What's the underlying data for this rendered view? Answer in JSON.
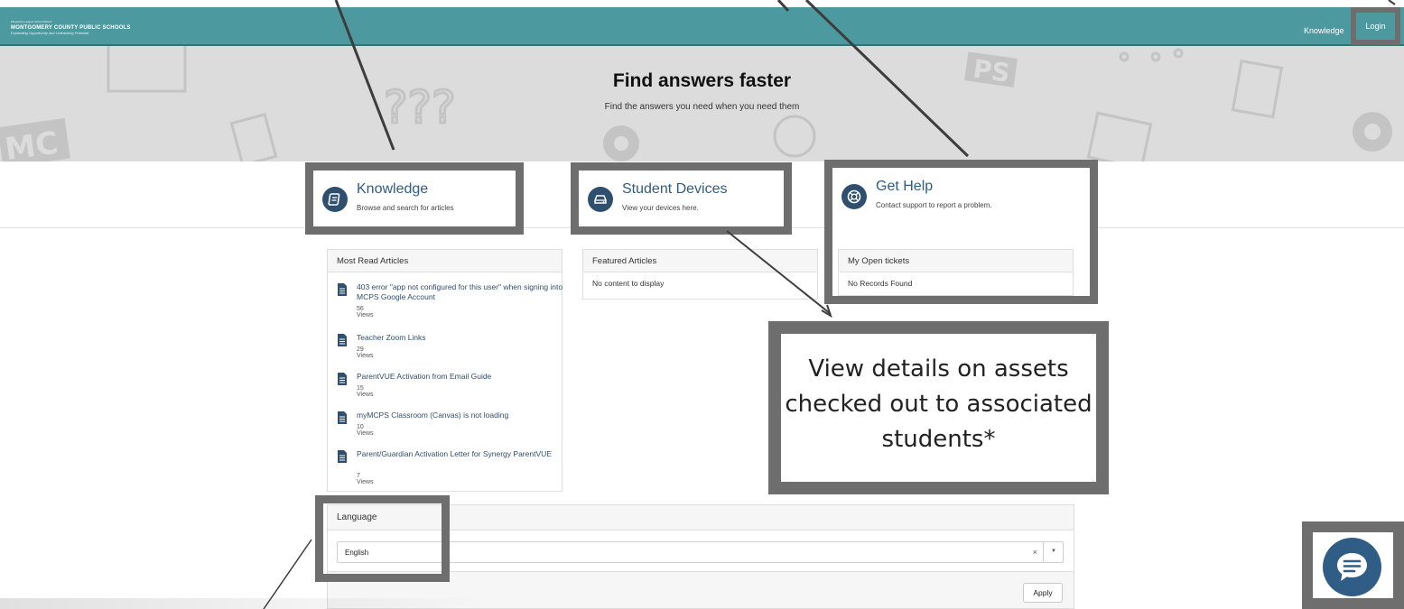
{
  "header": {
    "logo": {
      "tagline_top": "Maryland's Largest School District",
      "name": "MONTGOMERY COUNTY PUBLIC SCHOOLS",
      "tagline_bottom": "Expanding Opportunity and Unleashing Potential"
    },
    "nav": {
      "knowledge": "Knowledge",
      "login": "Login"
    }
  },
  "hero": {
    "title": "Find answers faster",
    "subtitle": "Find the answers you need when you need them"
  },
  "cards": [
    {
      "title": "Knowledge",
      "description": "Browse and search for articles",
      "icon": "book-icon"
    },
    {
      "title": "Student Devices",
      "description": "View your devices here.",
      "icon": "device-icon"
    },
    {
      "title": "Get Help",
      "description": "Contact support to report a problem.",
      "icon": "lifebuoy-icon"
    }
  ],
  "most_read": {
    "header": "Most Read Articles",
    "articles": [
      {
        "title": "403 error \"app not configured for this user\" when signing into MCPS Google Account",
        "views": "56 Views"
      },
      {
        "title": "Teacher Zoom Links",
        "views": "29 Views"
      },
      {
        "title": "ParentVUE Activation from Email Guide",
        "views": "15 Views"
      },
      {
        "title": "myMCPS Classroom (Canvas) is not loading",
        "views": "10 Views"
      },
      {
        "title": "Parent/Guardian Activation Letter for Synergy ParentVUE",
        "views": "7 Views"
      }
    ]
  },
  "featured": {
    "header": "Featured Articles",
    "empty": "No content to display"
  },
  "tickets": {
    "header": "My Open tickets",
    "empty": "No Records Found"
  },
  "callout": {
    "text": "View details on assets checked out to associated students*"
  },
  "language": {
    "header": "Language",
    "selected": "English",
    "clear": "×",
    "apply": "Apply"
  },
  "colors": {
    "navbar": "#4c9aa0",
    "card_icon": "#2f4f6e",
    "link": "#2f5d86",
    "annotation_border": "#6e6e6e"
  }
}
